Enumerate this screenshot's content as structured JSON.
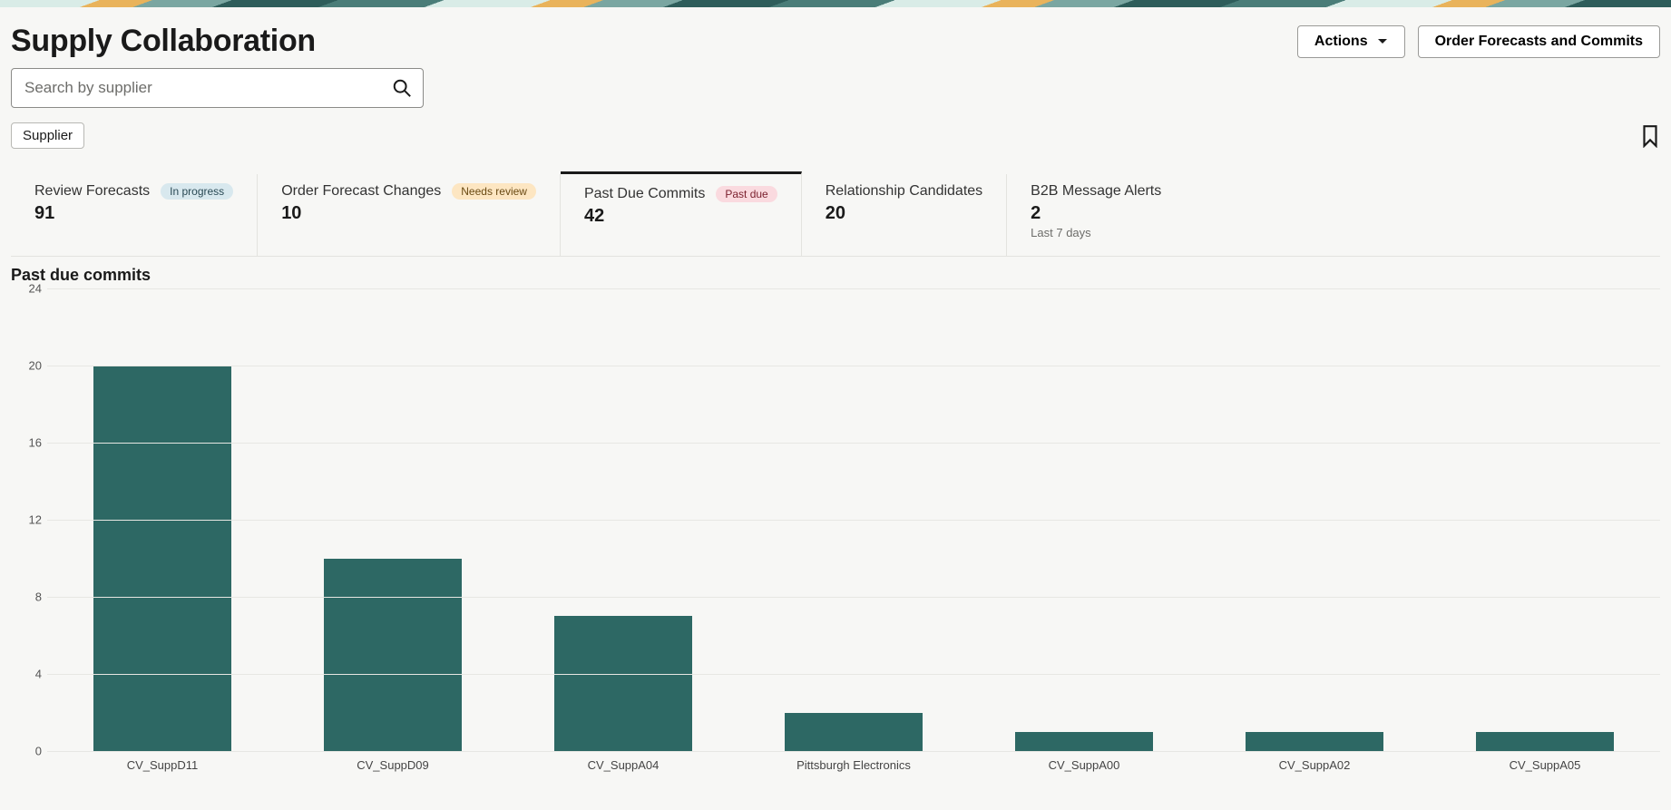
{
  "header": {
    "title": "Supply Collaboration",
    "actions_label": "Actions",
    "order_forecasts_label": "Order Forecasts and Commits"
  },
  "search": {
    "placeholder": "Search by supplier",
    "value": ""
  },
  "filters": {
    "chip_label": "Supplier"
  },
  "kpis": [
    {
      "id": "review-forecasts",
      "label": "Review Forecasts",
      "value": "91",
      "badge": "In progress",
      "badge_color": "blue",
      "active": false
    },
    {
      "id": "order-forecast-changes",
      "label": "Order Forecast Changes",
      "value": "10",
      "badge": "Needs review",
      "badge_color": "orange",
      "active": false
    },
    {
      "id": "past-due-commits",
      "label": "Past Due Commits",
      "value": "42",
      "badge": "Past due",
      "badge_color": "red",
      "active": true
    },
    {
      "id": "relationship-candidates",
      "label": "Relationship Candidates",
      "value": "20",
      "badge": null,
      "active": false
    },
    {
      "id": "b2b-message-alerts",
      "label": "B2B Message Alerts",
      "value": "2",
      "badge": null,
      "sub": "Last 7 days",
      "active": false
    }
  ],
  "chart_section_title": "Past due commits",
  "chart_data": {
    "type": "bar",
    "title": "Past due commits",
    "xlabel": "",
    "ylabel": "",
    "ylim": [
      0,
      24
    ],
    "yticks": [
      0,
      4,
      8,
      12,
      16,
      20,
      24
    ],
    "categories": [
      "CV_SuppD11",
      "CV_SuppD09",
      "CV_SuppA04",
      "Pittsburgh Electronics",
      "CV_SuppA00",
      "CV_SuppA02",
      "CV_SuppA05"
    ],
    "values": [
      20,
      10,
      7,
      2,
      1,
      1,
      1
    ],
    "bar_color": "#2d6864"
  }
}
